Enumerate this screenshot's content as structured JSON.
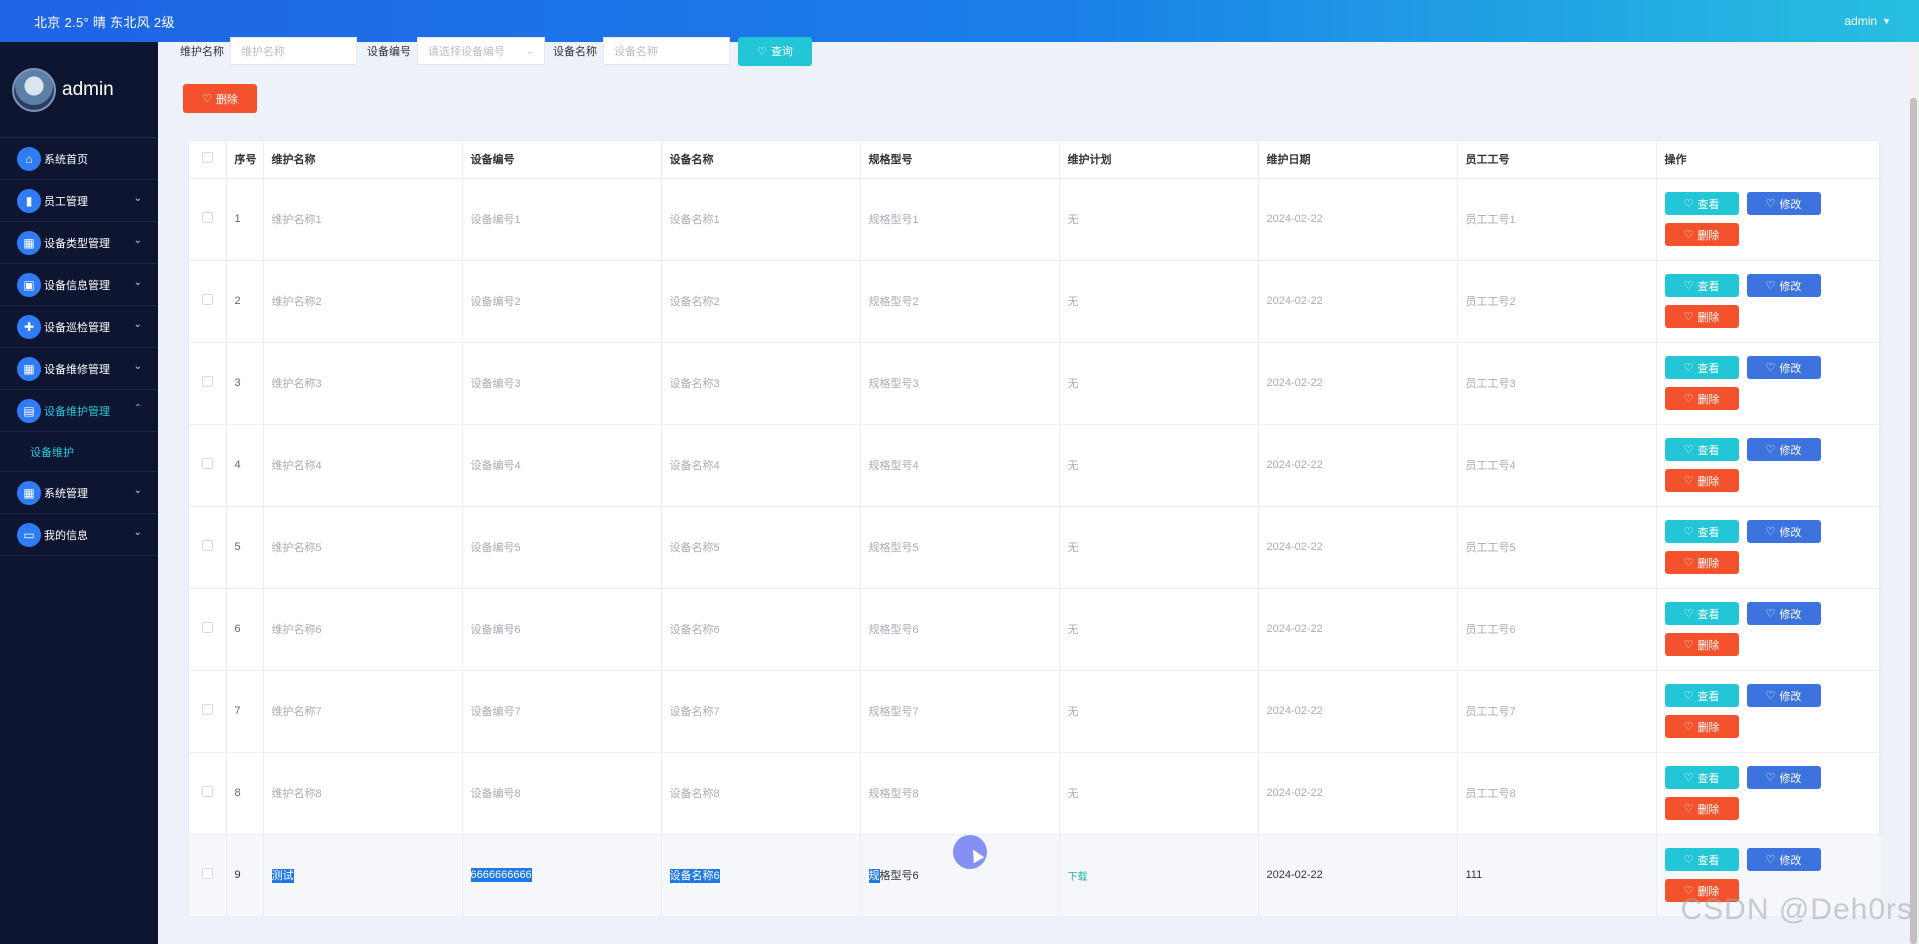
{
  "topbar": {
    "weather": "北京  2.5°  晴  东北风  2级",
    "user": "admin",
    "caret": "▼"
  },
  "sidebar": {
    "username": "admin",
    "items": [
      {
        "label": "系统首页",
        "icon": "home-icon",
        "glyph": "⌂",
        "chevron": ""
      },
      {
        "label": "员工管理",
        "icon": "bar-chart-icon",
        "glyph": "▮",
        "chevron": "⌄"
      },
      {
        "label": "设备类型管理",
        "icon": "grid-icon",
        "glyph": "▦",
        "chevron": "⌄"
      },
      {
        "label": "设备信息管理",
        "icon": "image-icon",
        "glyph": "▣",
        "chevron": "⌄"
      },
      {
        "label": "设备巡检管理",
        "icon": "thumb-icon",
        "glyph": "✚",
        "chevron": "⌄"
      },
      {
        "label": "设备维修管理",
        "icon": "grid-icon",
        "glyph": "▦",
        "chevron": "⌄"
      },
      {
        "label": "设备维护管理",
        "icon": "inbox-icon",
        "glyph": "▤",
        "chevron": "⌃"
      },
      {
        "label": "系统管理",
        "icon": "grid-icon",
        "glyph": "▦",
        "chevron": "⌄"
      },
      {
        "label": "我的信息",
        "icon": "card-icon",
        "glyph": "▭",
        "chevron": "⌄"
      }
    ],
    "submenu_label": "设备维护"
  },
  "search": {
    "label1": "维护名称",
    "placeholder1": "维护名称",
    "label2": "设备编号",
    "placeholder2": "请选择设备编号",
    "label3": "设备名称",
    "placeholder3": "设备名称",
    "query_button": "查询"
  },
  "toolbar": {
    "delete_label": "删除"
  },
  "table": {
    "headers": [
      "序号",
      "维护名称",
      "设备编号",
      "设备名称",
      "规格型号",
      "维护计划",
      "维护日期",
      "员工工号",
      "操作"
    ],
    "rows": [
      {
        "idx": "1",
        "name": "维护名称1",
        "code": "设备编号1",
        "device": "设备名称1",
        "model": "规格型号1",
        "plan": "无",
        "date": "2024-02-22",
        "emp": "员工工号1"
      },
      {
        "idx": "2",
        "name": "维护名称2",
        "code": "设备编号2",
        "device": "设备名称2",
        "model": "规格型号2",
        "plan": "无",
        "date": "2024-02-22",
        "emp": "员工工号2"
      },
      {
        "idx": "3",
        "name": "维护名称3",
        "code": "设备编号3",
        "device": "设备名称3",
        "model": "规格型号3",
        "plan": "无",
        "date": "2024-02-22",
        "emp": "员工工号3"
      },
      {
        "idx": "4",
        "name": "维护名称4",
        "code": "设备编号4",
        "device": "设备名称4",
        "model": "规格型号4",
        "plan": "无",
        "date": "2024-02-22",
        "emp": "员工工号4"
      },
      {
        "idx": "5",
        "name": "维护名称5",
        "code": "设备编号5",
        "device": "设备名称5",
        "model": "规格型号5",
        "plan": "无",
        "date": "2024-02-22",
        "emp": "员工工号5"
      },
      {
        "idx": "6",
        "name": "维护名称6",
        "code": "设备编号6",
        "device": "设备名称6",
        "model": "规格型号6",
        "plan": "无",
        "date": "2024-02-22",
        "emp": "员工工号6"
      },
      {
        "idx": "7",
        "name": "维护名称7",
        "code": "设备编号7",
        "device": "设备名称7",
        "model": "规格型号7",
        "plan": "无",
        "date": "2024-02-22",
        "emp": "员工工号7"
      },
      {
        "idx": "8",
        "name": "维护名称8",
        "code": "设备编号8",
        "device": "设备名称8",
        "model": "规格型号8",
        "plan": "无",
        "date": "2024-02-22",
        "emp": "员工工号8"
      }
    ],
    "last_row": {
      "idx": "9",
      "name": "测试",
      "code": "6666666666",
      "device": "设备名称6",
      "model_sel": "规",
      "model_rest": "格型号6",
      "plan": "下载",
      "date": "2024-02-22",
      "emp": "111"
    },
    "actions": {
      "view": "查看",
      "edit": "修改",
      "delete": "删除"
    }
  },
  "watermark": "CSDN @Deh0rs",
  "colors": {
    "topbar_start": "#1f63e6",
    "topbar_end": "#27bfe0",
    "sidebar": "#0d1531",
    "accent_cyan": "#22c6d6",
    "accent_blue": "#3d73df",
    "danger": "#f4522d"
  }
}
